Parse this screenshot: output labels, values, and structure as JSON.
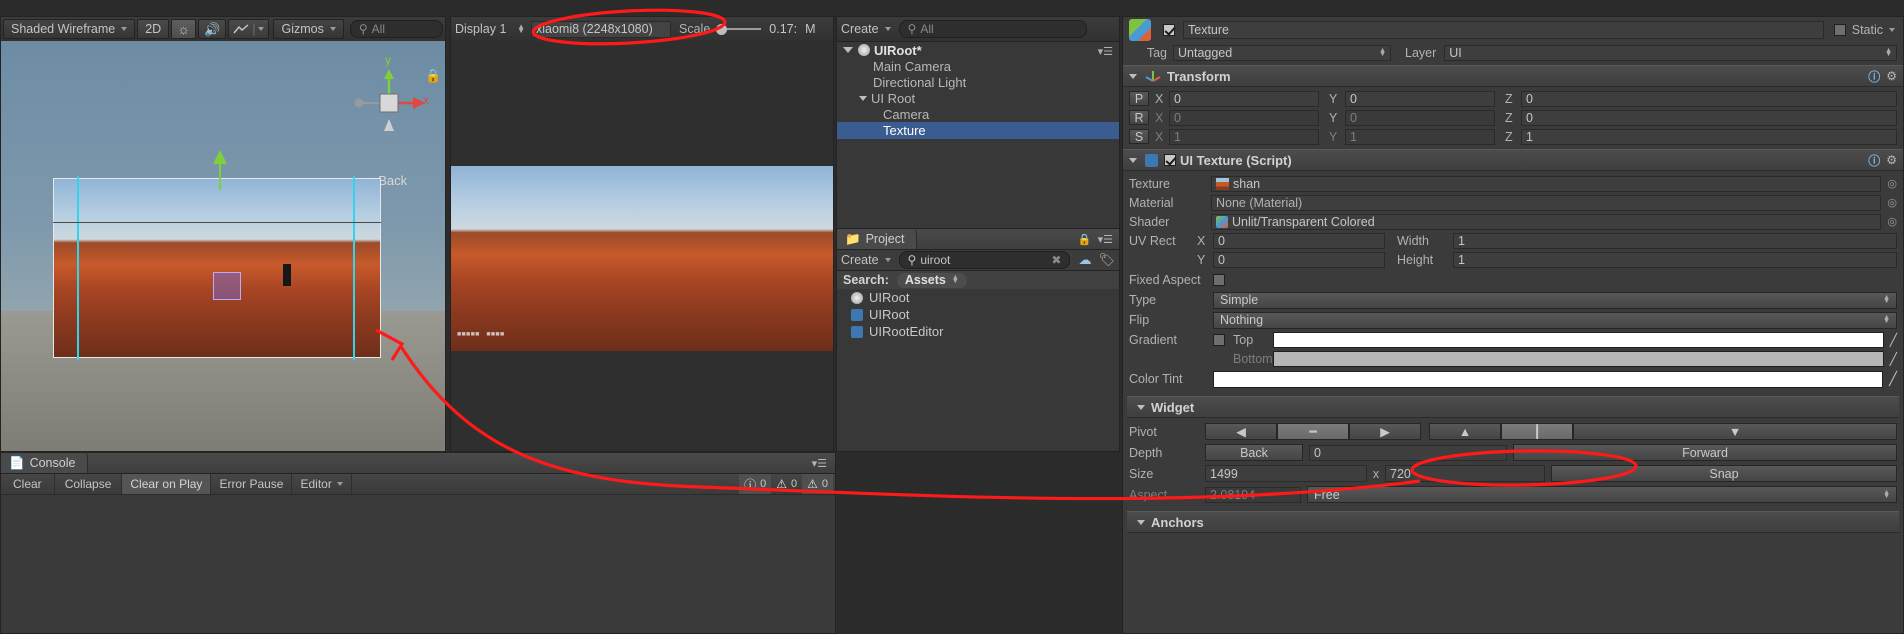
{
  "scene_toolbar": {
    "draw_mode": "Shaded Wireframe",
    "mode_2d": "2D",
    "light_icon": "lighting-icon",
    "audio_icon": "audio-icon",
    "fx_icon": "effects-icon",
    "gizmos": "Gizmos",
    "search_placeholder": "All",
    "back_label": "< Back",
    "axis_x": "x",
    "axis_y": "y"
  },
  "game_toolbar": {
    "display": "Display 1",
    "resolution": "xiaomi8 (2248x1080)",
    "scale_label": "Scale",
    "scale_value": "0.17:",
    "maximize_label": "M"
  },
  "hierarchy": {
    "create_label": "Create",
    "search_placeholder": "All",
    "items": [
      {
        "label": "UIRoot*",
        "depth": 0,
        "icon": "unity-scene-icon",
        "expanded": true,
        "selected": false
      },
      {
        "label": "Main Camera",
        "depth": 1,
        "icon": "",
        "expanded": false,
        "selected": false
      },
      {
        "label": "Directional Light",
        "depth": 1,
        "icon": "",
        "expanded": false,
        "selected": false
      },
      {
        "label": "UI Root",
        "depth": 1,
        "icon": "",
        "expanded": true,
        "selected": false
      },
      {
        "label": "Camera",
        "depth": 2,
        "icon": "",
        "expanded": false,
        "selected": false
      },
      {
        "label": "Texture",
        "depth": 2,
        "icon": "",
        "expanded": false,
        "selected": true
      }
    ]
  },
  "project": {
    "tab_label": "Project",
    "create_label": "Create",
    "search_value": "uiroot",
    "search_label": "Search:",
    "search_scope": "Assets",
    "items": [
      {
        "label": "UIRoot",
        "icon": "prefab-icon"
      },
      {
        "label": "UIRoot",
        "icon": "csharp-script-icon"
      },
      {
        "label": "UIRootEditor",
        "icon": "csharp-script-icon"
      }
    ]
  },
  "console": {
    "tab_label": "Console",
    "buttons": [
      "Clear",
      "Collapse",
      "Clear on Play",
      "Error Pause",
      "Editor"
    ],
    "counts": {
      "log": "0",
      "warning": "0",
      "error": "0"
    }
  },
  "inspector": {
    "object_name": "Texture",
    "enabled": true,
    "static_label": "Static",
    "tag_label": "Tag",
    "tag_value": "Untagged",
    "layer_label": "Layer",
    "layer_value": "UI",
    "transform": {
      "title": "Transform",
      "rows": [
        {
          "key": "P",
          "x": "0",
          "y": "0",
          "z": "0",
          "dim": false
        },
        {
          "key": "R",
          "x": "0",
          "y": "0",
          "z": "0",
          "dim": true
        },
        {
          "key": "S",
          "x": "1",
          "y": "1",
          "z": "1",
          "dim": true
        }
      ],
      "axis_labels": [
        "X",
        "Y",
        "Z"
      ]
    },
    "ui_texture": {
      "title": "UI Texture (Script)",
      "enabled": true,
      "texture_label": "Texture",
      "texture_value": "shan",
      "material_label": "Material",
      "material_value": "None (Material)",
      "shader_label": "Shader",
      "shader_value": "Unlit/Transparent Colored",
      "uvrect_label": "UV Rect",
      "uvrect_x_axis": "X",
      "uvrect_x": "0",
      "uvrect_y_axis": "Y",
      "uvrect_y": "0",
      "width_label": "Width",
      "width_value": "1",
      "height_label": "Height",
      "height_value": "1",
      "fixed_aspect_label": "Fixed Aspect",
      "fixed_aspect": false,
      "type_label": "Type",
      "type_value": "Simple",
      "flip_label": "Flip",
      "flip_value": "Nothing",
      "gradient_label": "Gradient",
      "gradient_enabled": false,
      "gradient_top_label": "Top",
      "gradient_bottom_label": "Bottom",
      "gradient_top_color": "#ffffff",
      "gradient_bottom_color": "#b6b6b6",
      "color_tint_label": "Color Tint",
      "color_tint_color": "#ffffff"
    },
    "widget": {
      "title": "Widget",
      "pivot_label": "Pivot",
      "depth_label": "Depth",
      "depth_back": "Back",
      "depth_value": "0",
      "depth_forward": "Forward",
      "size_label": "Size",
      "size_width": "1499",
      "size_x": "x",
      "size_height": "720",
      "snap_label": "Snap",
      "aspect_label": "Aspect",
      "aspect_value": "2.08194",
      "aspect_mode": "Free"
    },
    "anchors": {
      "title": "Anchors"
    }
  },
  "annotations": {
    "accent_color": "#ff1a1a",
    "ellipse_resolution": "highlight-resolution-dropdown",
    "ellipse_size": "highlight-widget-size",
    "arrow": "arrow-from-size-to-scene-view"
  }
}
